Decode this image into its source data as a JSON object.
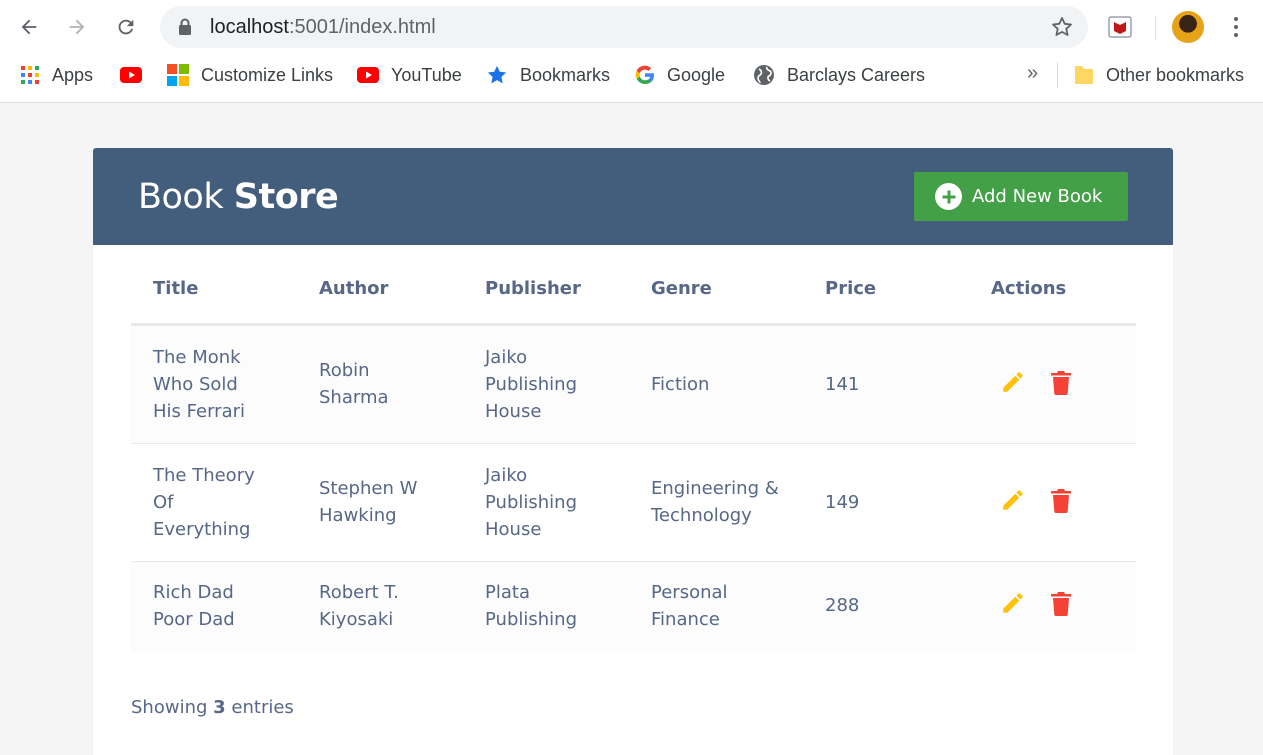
{
  "browser": {
    "url_host": "localhost",
    "url_rest": ":5001/index.html",
    "bookmarks": [
      {
        "label": "Apps",
        "icon": "apps-grid-icon"
      },
      {
        "label": "",
        "icon": "youtube-icon"
      },
      {
        "label": "Customize Links",
        "icon": "microsoft-icon"
      },
      {
        "label": "YouTube",
        "icon": "youtube-icon"
      },
      {
        "label": "Bookmarks",
        "icon": "star-icon"
      },
      {
        "label": "Google",
        "icon": "google-icon"
      },
      {
        "label": "Barclays Careers",
        "icon": "globe-icon"
      }
    ],
    "more_label": "»",
    "other_bookmarks": "Other bookmarks"
  },
  "app": {
    "title_light": "Book",
    "title_bold": "Store",
    "add_button_label": "Add New Book",
    "accent_color": "#435d7d",
    "button_color": "#43a047"
  },
  "table": {
    "headers": [
      "Title",
      "Author",
      "Publisher",
      "Genre",
      "Price",
      "Actions"
    ],
    "rows": [
      {
        "title": "The Monk Who Sold His Ferrari",
        "author": "Robin Sharma",
        "publisher": "Jaiko Publishing House",
        "genre": "Fiction",
        "price": "141"
      },
      {
        "title": "The Theory Of Everything",
        "author": "Stephen W Hawking",
        "publisher": "Jaiko Publishing House",
        "genre": "Engineering & Technology",
        "price": "149"
      },
      {
        "title": "Rich Dad Poor Dad",
        "author": "Robert T. Kiyosaki",
        "publisher": "Plata Publishing",
        "genre": "Personal Finance",
        "price": "288"
      }
    ]
  },
  "footer": {
    "prefix": "Showing",
    "count": "3",
    "suffix": "entries"
  }
}
